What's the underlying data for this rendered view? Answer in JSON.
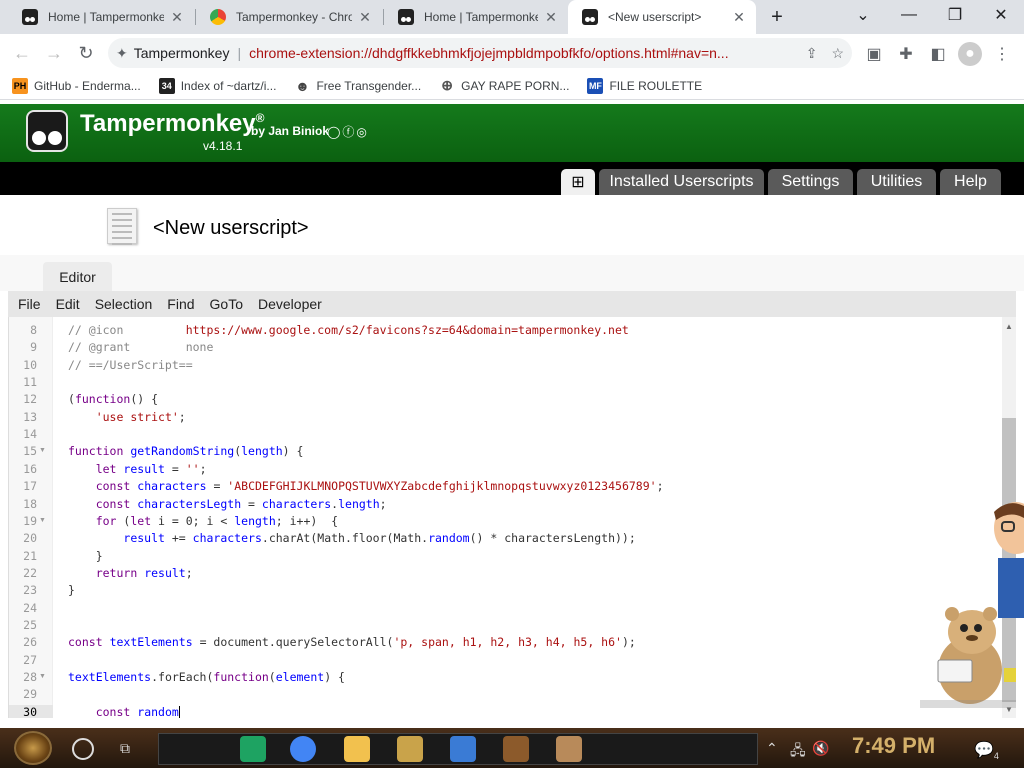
{
  "tabs": [
    {
      "title": "Home | Tampermonkey",
      "icon": "tampermonkey-icon"
    },
    {
      "title": "Tampermonkey - Chrome",
      "icon": "chrome-web-store-icon"
    },
    {
      "title": "Home | Tampermonkey",
      "icon": "tampermonkey-icon"
    },
    {
      "title": "<New userscript>",
      "icon": "tampermonkey-icon"
    }
  ],
  "new_tab": "+",
  "window": {
    "minimize": "—",
    "restore": "❐",
    "close": "✕",
    "tab_search": "⌄"
  },
  "omnibox": {
    "ext_name": "Tampermonkey",
    "separator": "|",
    "url": "chrome-extension://dhdgffkkebhmkfjojejmpbldmpobfkfo/options.html#nav=n..."
  },
  "bookmarks": [
    {
      "label": "GitHub - Enderma...",
      "icon": "PH",
      "color": "#f7931e"
    },
    {
      "label": "Index of ~dartz/i...",
      "icon": "34",
      "color": "#222222"
    },
    {
      "label": "Free Transgender...",
      "icon": "☻",
      "color": "#444444"
    },
    {
      "label": "GAY RAPE PORN...",
      "icon": "⊕",
      "color": "#555555"
    },
    {
      "label": "FILE ROULETTE",
      "icon": "MF",
      "color": "#1a4fb5"
    }
  ],
  "tm": {
    "name": "Tampermonkey",
    "registered": "®",
    "by": "by Jan Biniok",
    "version": "v4.18.1",
    "social": "◯ⓕ◎"
  },
  "nav": {
    "new_icon": "⊞",
    "items": [
      "Installed Userscripts",
      "Settings",
      "Utilities",
      "Help"
    ]
  },
  "script_title": "<New userscript>",
  "editor_tab": "Editor",
  "menu": [
    "File",
    "Edit",
    "Selection",
    "Find",
    "GoTo",
    "Developer"
  ],
  "code_lines": [
    {
      "n": "8",
      "text": "// @icon         https://www.google.com/s2/favicons?sz=64&domain=tampermonkey.net"
    },
    {
      "n": "9",
      "text": "// @grant        none"
    },
    {
      "n": "10",
      "text": "// ==/UserScript=="
    },
    {
      "n": "11",
      "text": ""
    },
    {
      "n": "12",
      "text": "(function() {"
    },
    {
      "n": "13",
      "text": "    'use strict';"
    },
    {
      "n": "14",
      "text": ""
    },
    {
      "n": "15",
      "text": "function getRandomString(length) {",
      "fold": true
    },
    {
      "n": "16",
      "text": "    let result = '';"
    },
    {
      "n": "17",
      "text": "    const characters = 'ABCDEFGHIJKLMNOPQSTUVWXYZabcdefghijklmnopqstuvwxyz0123456789';"
    },
    {
      "n": "18",
      "text": "    const charactersLegth = characters.length;"
    },
    {
      "n": "19",
      "text": "    for (let i = 0; i < length; i++)  {",
      "fold": true
    },
    {
      "n": "20",
      "text": "        result += characters.charAt(Math.floor(Math.random() * charactersLength));"
    },
    {
      "n": "21",
      "text": "    }"
    },
    {
      "n": "22",
      "text": "    return result;"
    },
    {
      "n": "23",
      "text": "}"
    },
    {
      "n": "24",
      "text": ""
    },
    {
      "n": "25",
      "text": ""
    },
    {
      "n": "26",
      "text": "const textElements = document.querySelectorAll('p, span, h1, h2, h3, h4, h5, h6');"
    },
    {
      "n": "27",
      "text": ""
    },
    {
      "n": "28",
      "text": "textElements.forEach(function(element) {",
      "fold": true
    },
    {
      "n": "29",
      "text": ""
    },
    {
      "n": "30",
      "text": "    const random",
      "current": true
    }
  ],
  "taskbar": {
    "time": "7:49 PM",
    "notification_count": "4",
    "apps": [
      {
        "name": "sheets-icon",
        "color": "#1ea362"
      },
      {
        "name": "chrome-icon",
        "color": "#4285f4"
      },
      {
        "name": "file-explorer-icon",
        "color": "#f2c14e"
      },
      {
        "name": "game-app-icon",
        "color": "#c9a34a"
      },
      {
        "name": "blue-app-icon",
        "color": "#3a7bd5"
      },
      {
        "name": "monkey-app-icon",
        "color": "#8c5a2b"
      },
      {
        "name": "figure-app-icon",
        "color": "#b88a5a"
      }
    ]
  },
  "colors": {
    "tm_green": "#0b6110",
    "nav_bg": "#000000",
    "tab_inactive": "#5a5a5a"
  }
}
